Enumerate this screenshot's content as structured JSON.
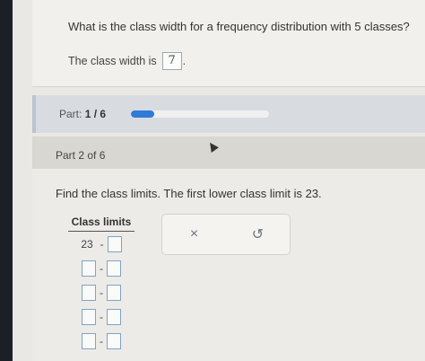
{
  "question": {
    "text": "What is the class width for a frequency distribution with 5 classes?",
    "answer_label": "The class width is",
    "answer_value": "7",
    "answer_suffix": "."
  },
  "part_progress": {
    "label_prefix": "Part:",
    "label_value": "1 / 6",
    "progress_fraction": 0.1667,
    "fill_color": "#2f7bd8"
  },
  "part2": {
    "label": "Part 2 of 6",
    "instruction": "Find the class limits. The first lower class limit is 23.",
    "table_header": "Class limits",
    "rows": [
      {
        "lower": "23",
        "separator": "-"
      },
      {
        "lower": "",
        "separator": "-"
      },
      {
        "lower": "",
        "separator": "-"
      },
      {
        "lower": "",
        "separator": "-"
      },
      {
        "lower": "",
        "separator": "-"
      }
    ]
  },
  "toolbox": {
    "clear_icon": "x-icon",
    "clear_glyph": "×",
    "undo_icon": "undo-icon",
    "undo_glyph": "↺"
  }
}
